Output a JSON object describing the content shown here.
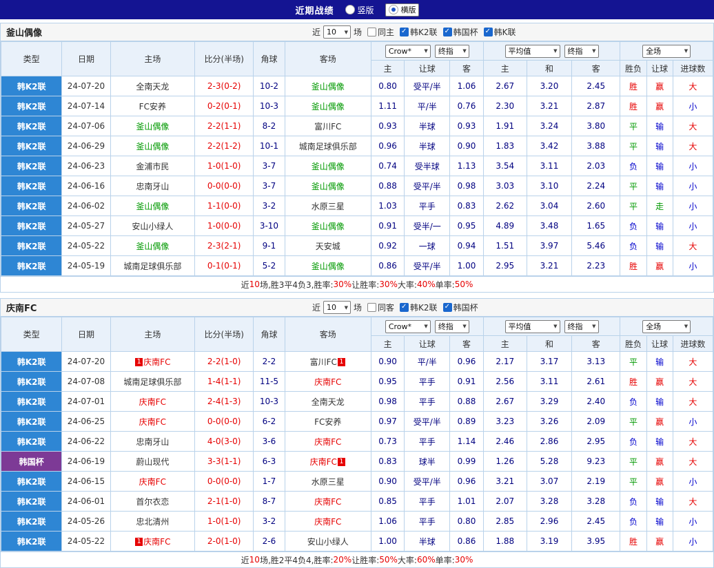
{
  "colors": {
    "topbar_bg": "#141492",
    "league_blue": "#2e86d4",
    "league_purple": "#7d3a96",
    "team_green": "#009900",
    "team_red": "#e60000",
    "score_red": "#e60000",
    "odds_navy": "#000080",
    "win_red": "#e60000",
    "draw_green": "#009900",
    "lose_blue": "#0000cc"
  },
  "topbar": {
    "title": "近期战绩",
    "radios": [
      {
        "label": "竖版",
        "selected": false
      },
      {
        "label": "横版",
        "selected": true
      }
    ]
  },
  "table_header": {
    "left_cols": [
      "类型",
      "日期",
      "主场",
      "比分(半场)",
      "角球",
      "客场"
    ],
    "groups": [
      {
        "selects": [
          {
            "label": "Crow*",
            "name": "bookmaker-select"
          },
          {
            "label": "终指",
            "name": "odds-type-select"
          }
        ],
        "cols": [
          "主",
          "让球",
          "客"
        ]
      },
      {
        "selects": [
          {
            "label": "平均值",
            "name": "average-odds-select"
          },
          {
            "label": "终指",
            "name": "odds-type-select"
          }
        ],
        "cols": [
          "主",
          "和",
          "客"
        ]
      },
      {
        "selects": [
          {
            "label": "全场",
            "name": "match-scope-select"
          }
        ],
        "cols": [
          "胜负",
          "让球",
          "进球数"
        ]
      }
    ]
  },
  "sections": [
    {
      "team": "釜山偶像",
      "team_color": "#009900",
      "filter": {
        "near": "近",
        "count": "10",
        "games": "场",
        "checkboxes": [
          {
            "label": "同主",
            "checked": false
          },
          {
            "label": "韩K2联",
            "checked": true
          },
          {
            "label": "韩国杯",
            "checked": true
          },
          {
            "label": "韩K联",
            "checked": true
          }
        ]
      },
      "rows": [
        {
          "league": "韩K2联",
          "cup": false,
          "date": "24-07-20",
          "home": {
            "name": "全南天龙",
            "hl": false,
            "card": null
          },
          "score": "2-3(0-2)",
          "corner": "10-2",
          "away": {
            "name": "釜山偶像",
            "hl": true,
            "card": null
          },
          "odds": [
            "0.80",
            "受平/半",
            "1.06"
          ],
          "avg": [
            "2.67",
            "3.20",
            "2.45"
          ],
          "res": [
            "胜",
            "赢",
            "大"
          ]
        },
        {
          "league": "韩K2联",
          "cup": false,
          "date": "24-07-14",
          "home": {
            "name": "FC安养",
            "hl": false,
            "card": null
          },
          "score": "0-2(0-1)",
          "corner": "10-3",
          "away": {
            "name": "釜山偶像",
            "hl": true,
            "card": null
          },
          "odds": [
            "1.11",
            "平/半",
            "0.76"
          ],
          "avg": [
            "2.30",
            "3.21",
            "2.87"
          ],
          "res": [
            "胜",
            "赢",
            "小"
          ]
        },
        {
          "league": "韩K2联",
          "cup": false,
          "date": "24-07-06",
          "home": {
            "name": "釜山偶像",
            "hl": true,
            "card": null
          },
          "score": "2-2(1-1)",
          "corner": "8-2",
          "away": {
            "name": "富川FC",
            "hl": false,
            "card": null
          },
          "odds": [
            "0.93",
            "半球",
            "0.93"
          ],
          "avg": [
            "1.91",
            "3.24",
            "3.80"
          ],
          "res": [
            "平",
            "输",
            "大"
          ]
        },
        {
          "league": "韩K2联",
          "cup": false,
          "date": "24-06-29",
          "home": {
            "name": "釜山偶像",
            "hl": true,
            "card": null
          },
          "score": "2-2(1-2)",
          "corner": "10-1",
          "away": {
            "name": "城南足球俱乐部",
            "hl": false,
            "card": null
          },
          "odds": [
            "0.96",
            "半球",
            "0.90"
          ],
          "avg": [
            "1.83",
            "3.42",
            "3.88"
          ],
          "res": [
            "平",
            "输",
            "大"
          ]
        },
        {
          "league": "韩K2联",
          "cup": false,
          "date": "24-06-23",
          "home": {
            "name": "金浦市民",
            "hl": false,
            "card": null
          },
          "score": "1-0(1-0)",
          "corner": "3-7",
          "away": {
            "name": "釜山偶像",
            "hl": true,
            "card": null
          },
          "odds": [
            "0.74",
            "受半球",
            "1.13"
          ],
          "avg": [
            "3.54",
            "3.11",
            "2.03"
          ],
          "res": [
            "负",
            "输",
            "小"
          ]
        },
        {
          "league": "韩K2联",
          "cup": false,
          "date": "24-06-16",
          "home": {
            "name": "忠南牙山",
            "hl": false,
            "card": null
          },
          "score": "0-0(0-0)",
          "corner": "3-7",
          "away": {
            "name": "釜山偶像",
            "hl": true,
            "card": null
          },
          "odds": [
            "0.88",
            "受平/半",
            "0.98"
          ],
          "avg": [
            "3.03",
            "3.10",
            "2.24"
          ],
          "res": [
            "平",
            "输",
            "小"
          ]
        },
        {
          "league": "韩K2联",
          "cup": false,
          "date": "24-06-02",
          "home": {
            "name": "釜山偶像",
            "hl": true,
            "card": null
          },
          "score": "1-1(0-0)",
          "corner": "3-2",
          "away": {
            "name": "水原三星",
            "hl": false,
            "card": null
          },
          "odds": [
            "1.03",
            "平手",
            "0.83"
          ],
          "avg": [
            "2.62",
            "3.04",
            "2.60"
          ],
          "res": [
            "平",
            "走",
            "小"
          ]
        },
        {
          "league": "韩K2联",
          "cup": false,
          "date": "24-05-27",
          "home": {
            "name": "安山小绿人",
            "hl": false,
            "card": null
          },
          "score": "1-0(0-0)",
          "corner": "3-10",
          "away": {
            "name": "釜山偶像",
            "hl": true,
            "card": null
          },
          "odds": [
            "0.91",
            "受半/一",
            "0.95"
          ],
          "avg": [
            "4.89",
            "3.48",
            "1.65"
          ],
          "res": [
            "负",
            "输",
            "小"
          ]
        },
        {
          "league": "韩K2联",
          "cup": false,
          "date": "24-05-22",
          "home": {
            "name": "釜山偶像",
            "hl": true,
            "card": null
          },
          "score": "2-3(2-1)",
          "corner": "9-1",
          "away": {
            "name": "天安城",
            "hl": false,
            "card": null
          },
          "odds": [
            "0.92",
            "一球",
            "0.94"
          ],
          "avg": [
            "1.51",
            "3.97",
            "5.46"
          ],
          "res": [
            "负",
            "输",
            "大"
          ]
        },
        {
          "league": "韩K2联",
          "cup": false,
          "date": "24-05-19",
          "home": {
            "name": "城南足球俱乐部",
            "hl": false,
            "card": null
          },
          "score": "0-1(0-1)",
          "corner": "5-2",
          "away": {
            "name": "釜山偶像",
            "hl": true,
            "card": null
          },
          "odds": [
            "0.86",
            "受平/半",
            "1.00"
          ],
          "avg": [
            "2.95",
            "3.21",
            "2.23"
          ],
          "res": [
            "胜",
            "赢",
            "小"
          ]
        }
      ],
      "summary": [
        {
          "t": "近",
          "red": false
        },
        {
          "t": "10",
          "red": true
        },
        {
          "t": "场,胜3平4负3, ",
          "red": false
        },
        {
          "t": "胜率:",
          "red": false
        },
        {
          "t": "30%",
          "red": true
        },
        {
          "t": " 让胜率:",
          "red": false
        },
        {
          "t": "30%",
          "red": true
        },
        {
          "t": " 大率:",
          "red": false
        },
        {
          "t": "40%",
          "red": true
        },
        {
          "t": " 单率:",
          "red": false
        },
        {
          "t": "50%",
          "red": true
        }
      ]
    },
    {
      "team": "庆南FC",
      "team_color": "#e60000",
      "filter": {
        "near": "近",
        "count": "10",
        "games": "场",
        "checkboxes": [
          {
            "label": "同客",
            "checked": false
          },
          {
            "label": "韩K2联",
            "checked": true
          },
          {
            "label": "韩国杯",
            "checked": true
          }
        ]
      },
      "rows": [
        {
          "league": "韩K2联",
          "cup": false,
          "date": "24-07-20",
          "home": {
            "name": "庆南FC",
            "hl": true,
            "card": {
              "text": "1",
              "pos": "pre"
            }
          },
          "score": "2-2(1-0)",
          "corner": "2-2",
          "away": {
            "name": "富川FC",
            "hl": false,
            "card": {
              "text": "1",
              "pos": "post"
            }
          },
          "odds": [
            "0.90",
            "平/半",
            "0.96"
          ],
          "avg": [
            "2.17",
            "3.17",
            "3.13"
          ],
          "res": [
            "平",
            "输",
            "大"
          ]
        },
        {
          "league": "韩K2联",
          "cup": false,
          "date": "24-07-08",
          "home": {
            "name": "城南足球俱乐部",
            "hl": false,
            "card": null
          },
          "score": "1-4(1-1)",
          "corner": "11-5",
          "away": {
            "name": "庆南FC",
            "hl": true,
            "card": null
          },
          "odds": [
            "0.95",
            "平手",
            "0.91"
          ],
          "avg": [
            "2.56",
            "3.11",
            "2.61"
          ],
          "res": [
            "胜",
            "赢",
            "大"
          ]
        },
        {
          "league": "韩K2联",
          "cup": false,
          "date": "24-07-01",
          "home": {
            "name": "庆南FC",
            "hl": true,
            "card": null
          },
          "score": "2-4(1-3)",
          "corner": "10-3",
          "away": {
            "name": "全南天龙",
            "hl": false,
            "card": null
          },
          "odds": [
            "0.98",
            "平手",
            "0.88"
          ],
          "avg": [
            "2.67",
            "3.29",
            "2.40"
          ],
          "res": [
            "负",
            "输",
            "大"
          ]
        },
        {
          "league": "韩K2联",
          "cup": false,
          "date": "24-06-25",
          "home": {
            "name": "庆南FC",
            "hl": true,
            "card": null
          },
          "score": "0-0(0-0)",
          "corner": "6-2",
          "away": {
            "name": "FC安养",
            "hl": false,
            "card": null
          },
          "odds": [
            "0.97",
            "受平/半",
            "0.89"
          ],
          "avg": [
            "3.23",
            "3.26",
            "2.09"
          ],
          "res": [
            "平",
            "赢",
            "小"
          ]
        },
        {
          "league": "韩K2联",
          "cup": false,
          "date": "24-06-22",
          "home": {
            "name": "忠南牙山",
            "hl": false,
            "card": null
          },
          "score": "4-0(3-0)",
          "corner": "3-6",
          "away": {
            "name": "庆南FC",
            "hl": true,
            "card": null
          },
          "odds": [
            "0.73",
            "平手",
            "1.14"
          ],
          "avg": [
            "2.46",
            "2.86",
            "2.95"
          ],
          "res": [
            "负",
            "输",
            "大"
          ]
        },
        {
          "league": "韩国杯",
          "cup": true,
          "date": "24-06-19",
          "home": {
            "name": "蔚山现代",
            "hl": false,
            "card": null
          },
          "score": "3-3(1-1)",
          "corner": "6-3",
          "away": {
            "name": "庆南FC",
            "hl": true,
            "card": {
              "text": "1",
              "pos": "post"
            }
          },
          "odds": [
            "0.83",
            "球半",
            "0.99"
          ],
          "avg": [
            "1.26",
            "5.28",
            "9.23"
          ],
          "res": [
            "平",
            "赢",
            "大"
          ]
        },
        {
          "league": "韩K2联",
          "cup": false,
          "date": "24-06-15",
          "home": {
            "name": "庆南FC",
            "hl": true,
            "card": null
          },
          "score": "0-0(0-0)",
          "corner": "1-7",
          "away": {
            "name": "水原三星",
            "hl": false,
            "card": null
          },
          "odds": [
            "0.90",
            "受平/半",
            "0.96"
          ],
          "avg": [
            "3.21",
            "3.07",
            "2.19"
          ],
          "res": [
            "平",
            "赢",
            "小"
          ]
        },
        {
          "league": "韩K2联",
          "cup": false,
          "date": "24-06-01",
          "home": {
            "name": "首尔衣恋",
            "hl": false,
            "card": null
          },
          "score": "2-1(1-0)",
          "corner": "8-7",
          "away": {
            "name": "庆南FC",
            "hl": true,
            "card": null
          },
          "odds": [
            "0.85",
            "平手",
            "1.01"
          ],
          "avg": [
            "2.07",
            "3.28",
            "3.28"
          ],
          "res": [
            "负",
            "输",
            "大"
          ]
        },
        {
          "league": "韩K2联",
          "cup": false,
          "date": "24-05-26",
          "home": {
            "name": "忠北清州",
            "hl": false,
            "card": null
          },
          "score": "1-0(1-0)",
          "corner": "3-2",
          "away": {
            "name": "庆南FC",
            "hl": true,
            "card": null
          },
          "odds": [
            "1.06",
            "平手",
            "0.80"
          ],
          "avg": [
            "2.85",
            "2.96",
            "2.45"
          ],
          "res": [
            "负",
            "输",
            "小"
          ]
        },
        {
          "league": "韩K2联",
          "cup": false,
          "date": "24-05-22",
          "home": {
            "name": "庆南FC",
            "hl": true,
            "card": {
              "text": "1",
              "pos": "pre"
            }
          },
          "score": "2-0(1-0)",
          "corner": "2-6",
          "away": {
            "name": "安山小绿人",
            "hl": false,
            "card": null
          },
          "odds": [
            "1.00",
            "半球",
            "0.86"
          ],
          "avg": [
            "1.88",
            "3.19",
            "3.95"
          ],
          "res": [
            "胜",
            "赢",
            "小"
          ]
        }
      ],
      "summary": [
        {
          "t": "近",
          "red": false
        },
        {
          "t": "10",
          "red": true
        },
        {
          "t": "场,胜2平4负4, ",
          "red": false
        },
        {
          "t": "胜率:",
          "red": false
        },
        {
          "t": "20%",
          "red": true
        },
        {
          "t": " 让胜率:",
          "red": false
        },
        {
          "t": "50%",
          "red": true
        },
        {
          "t": " 大率:",
          "red": false
        },
        {
          "t": "60%",
          "red": true
        },
        {
          "t": " 单率:",
          "red": false
        },
        {
          "t": "30%",
          "red": true
        }
      ]
    }
  ]
}
